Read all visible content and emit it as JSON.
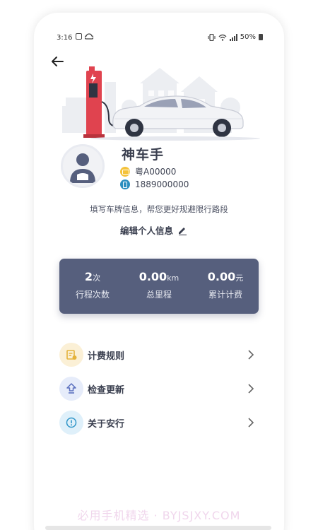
{
  "status_bar": {
    "time": "3:16",
    "battery": "50%"
  },
  "profile": {
    "name": "神车手",
    "plate": "粤A00000",
    "phone": "1889000000",
    "hint": "填写车牌信息，帮您更好规避限行路段",
    "edit_label": "编辑个人信息"
  },
  "stats": [
    {
      "value": "2",
      "unit": "次",
      "label": "行程次数"
    },
    {
      "value": "0.00",
      "unit": "km",
      "label": "总里程"
    },
    {
      "value": "0.00",
      "unit": "元",
      "label": "累计计费"
    }
  ],
  "menu": [
    {
      "label": "计费规则",
      "icon": "billing-rules-icon",
      "bg": "#fbf0d6",
      "fg": "#e4b23a"
    },
    {
      "label": "检查更新",
      "icon": "update-icon",
      "bg": "#e6ecfa",
      "fg": "#5a6fbe"
    },
    {
      "label": "关于安行",
      "icon": "info-icon",
      "bg": "#dff0fa",
      "fg": "#2f95c8"
    }
  ],
  "watermark": "必用手机精选 · BYJSJXY.COM",
  "colors": {
    "stats_bg": "#565f7d",
    "charger_red": "#e0434f",
    "text_dark": "#3a3f4f"
  }
}
